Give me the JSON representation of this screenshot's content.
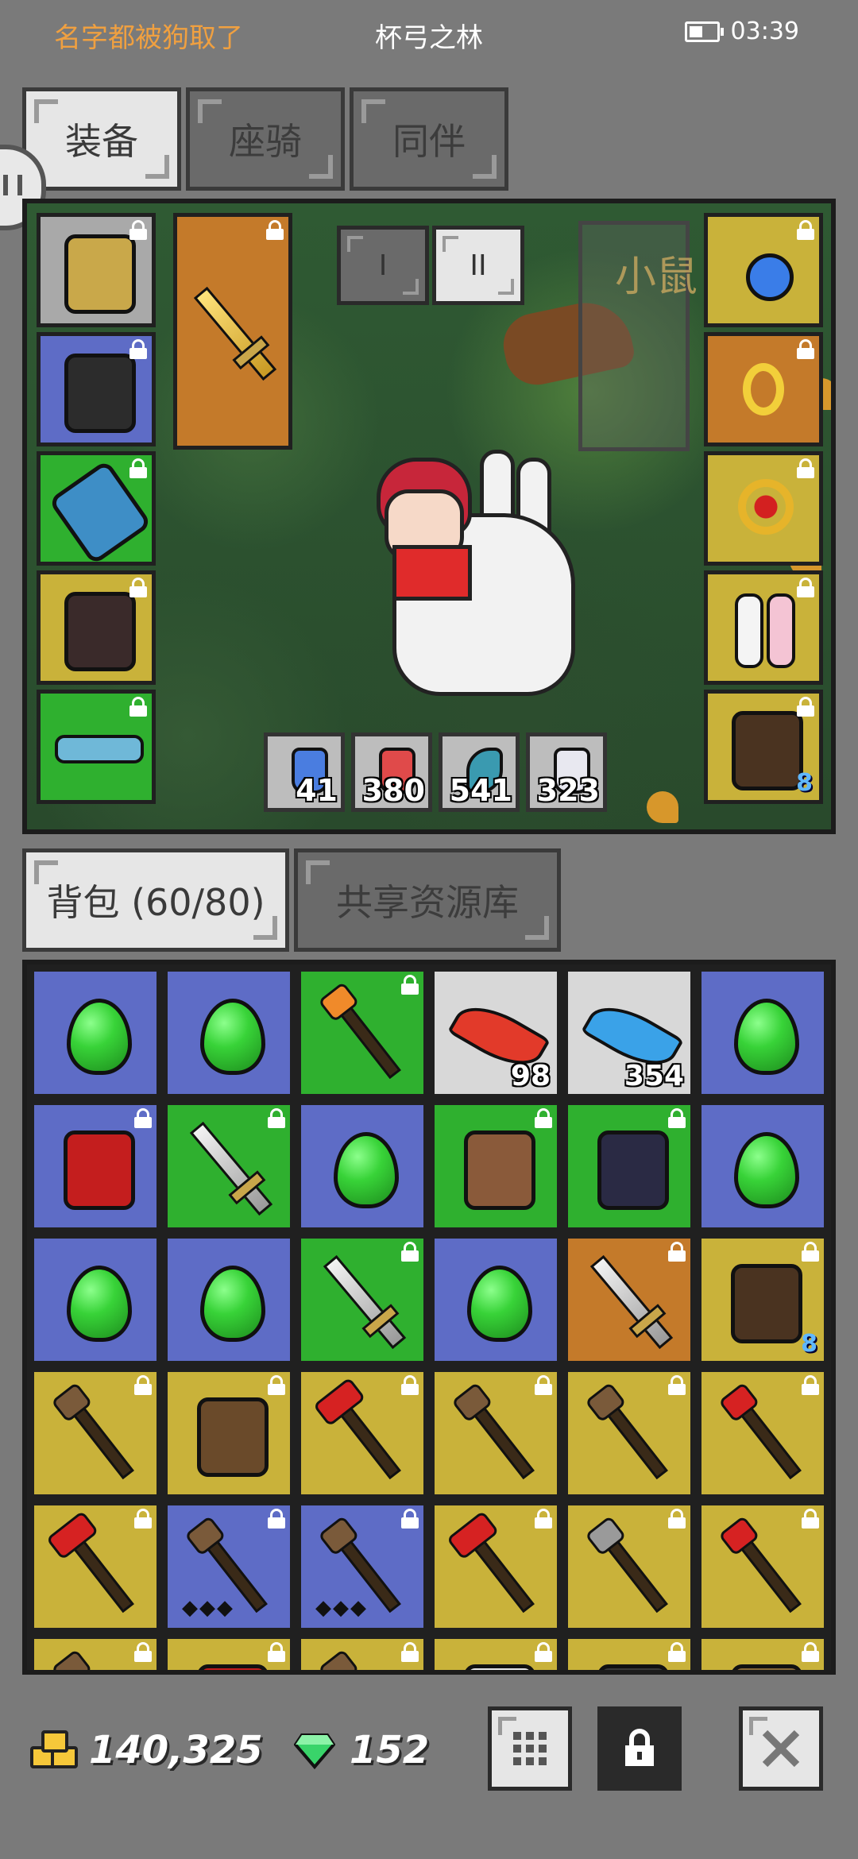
{
  "status_bar": {
    "player_name": "名字都被狗取了",
    "map_name": "杯弓之林",
    "time": "03:39"
  },
  "top_tabs": [
    {
      "label": "装备",
      "active": true
    },
    {
      "label": "座骑",
      "active": false
    },
    {
      "label": "同伴",
      "active": false
    }
  ],
  "scene": {
    "set_tabs": [
      {
        "label": "I",
        "active": false
      },
      {
        "label": "II",
        "active": true
      }
    ],
    "mount_label": "小鼠",
    "consumables": [
      {
        "icon": "blue-potion-icon",
        "count": "41"
      },
      {
        "icon": "red-potion-icon",
        "count": "380"
      },
      {
        "icon": "fish-icon",
        "count": "541"
      },
      {
        "icon": "white-potion-icon",
        "count": "323"
      }
    ],
    "left_slots": [
      {
        "icon": "golden-helmet-icon",
        "rarity": "gray"
      },
      {
        "icon": "dark-armor-icon",
        "rarity": "blue"
      },
      {
        "icon": "blue-gauntlet-icon",
        "rarity": "green"
      },
      {
        "icon": "dark-boots-icon",
        "rarity": "yellow"
      },
      {
        "icon": "blue-belt-icon",
        "rarity": "green"
      }
    ],
    "weapon_slot": {
      "icon": "golden-sword-icon",
      "rarity": "orange"
    },
    "right_slots": [
      {
        "icon": "sapphire-necklace-icon",
        "rarity": "yellow"
      },
      {
        "icon": "golden-ring-icon",
        "rarity": "orange"
      },
      {
        "icon": "ruby-ring-icon",
        "rarity": "yellow"
      },
      {
        "icon": "rabbit-ears-icon",
        "rarity": "yellow"
      },
      {
        "icon": "bear-hood-icon",
        "rarity": "yellow",
        "badge": "8"
      }
    ]
  },
  "bag_tabs": [
    {
      "label": "背包 (60/80)",
      "active": true
    },
    {
      "label": "共享资源库",
      "active": false
    }
  ],
  "inventory": [
    [
      {
        "icon": "green-egg-icon",
        "rarity": "blue"
      },
      {
        "icon": "green-egg-icon",
        "rarity": "blue"
      },
      {
        "icon": "fire-staff-icon",
        "rarity": "green",
        "locked": true
      },
      {
        "icon": "red-feather-icon",
        "rarity": "white",
        "count": "98"
      },
      {
        "icon": "blue-feather-icon",
        "rarity": "white",
        "count": "354"
      },
      {
        "icon": "green-egg-icon",
        "rarity": "blue"
      }
    ],
    [
      {
        "icon": "red-armor-icon",
        "rarity": "blue",
        "locked": true
      },
      {
        "icon": "scythe-icon",
        "rarity": "green",
        "locked": true
      },
      {
        "icon": "green-egg-icon",
        "rarity": "blue"
      },
      {
        "icon": "minotaur-mask-icon",
        "rarity": "green",
        "locked": true
      },
      {
        "icon": "dark-plate-icon",
        "rarity": "green",
        "locked": true
      },
      {
        "icon": "green-egg-icon",
        "rarity": "blue"
      }
    ],
    [
      {
        "icon": "green-egg-icon",
        "rarity": "blue"
      },
      {
        "icon": "green-egg-icon",
        "rarity": "blue"
      },
      {
        "icon": "scythe-icon",
        "rarity": "green",
        "locked": true
      },
      {
        "icon": "green-egg-icon",
        "rarity": "blue"
      },
      {
        "icon": "great-sword-icon",
        "rarity": "orange",
        "locked": true
      },
      {
        "icon": "bear-hood-icon",
        "rarity": "yellow",
        "locked": true,
        "badge": "8"
      }
    ],
    [
      {
        "icon": "spear-icon",
        "rarity": "yellow",
        "locked": true
      },
      {
        "icon": "leather-glove-icon",
        "rarity": "yellow",
        "locked": true
      },
      {
        "icon": "red-axe-icon",
        "rarity": "yellow",
        "locked": true
      },
      {
        "icon": "spear-icon",
        "rarity": "yellow",
        "locked": true
      },
      {
        "icon": "spear-icon",
        "rarity": "yellow",
        "locked": true
      },
      {
        "icon": "red-mace-icon",
        "rarity": "yellow",
        "locked": true
      }
    ],
    [
      {
        "icon": "red-axe-icon",
        "rarity": "yellow",
        "locked": true
      },
      {
        "icon": "spear-icon",
        "rarity": "blue",
        "locked": true,
        "gems": "◆◆◆"
      },
      {
        "icon": "spear-icon",
        "rarity": "blue",
        "locked": true,
        "gems": "◆◆◆"
      },
      {
        "icon": "red-axe-icon",
        "rarity": "yellow",
        "locked": true
      },
      {
        "icon": "halberd-icon",
        "rarity": "yellow",
        "locked": true
      },
      {
        "icon": "crossed-axes-icon",
        "rarity": "yellow",
        "locked": true
      }
    ],
    [
      {
        "icon": "spear-icon",
        "rarity": "yellow",
        "locked": true
      },
      {
        "icon": "red-armor-icon",
        "rarity": "yellow",
        "locked": true
      },
      {
        "icon": "spear-icon",
        "rarity": "yellow",
        "locked": true
      },
      {
        "icon": "bottle-icon",
        "rarity": "yellow",
        "locked": true
      },
      {
        "icon": "bomb-icon",
        "rarity": "yellow",
        "locked": true
      },
      {
        "icon": "chest-icon",
        "rarity": "yellow",
        "locked": true
      }
    ]
  ],
  "currency": {
    "gold": "140,325",
    "gems": "152"
  },
  "buttons": {
    "sort": "grid-sort-icon",
    "lock": "lock-icon",
    "close": "close-icon"
  },
  "colors": {
    "blue": "#5e6cc6",
    "green": "#2fb02f",
    "yellow": "#c9b23a",
    "orange": "#c47a2a",
    "white": "#d8d8d8",
    "gray": "#a9a9a9",
    "player_name": "#f0a040"
  }
}
